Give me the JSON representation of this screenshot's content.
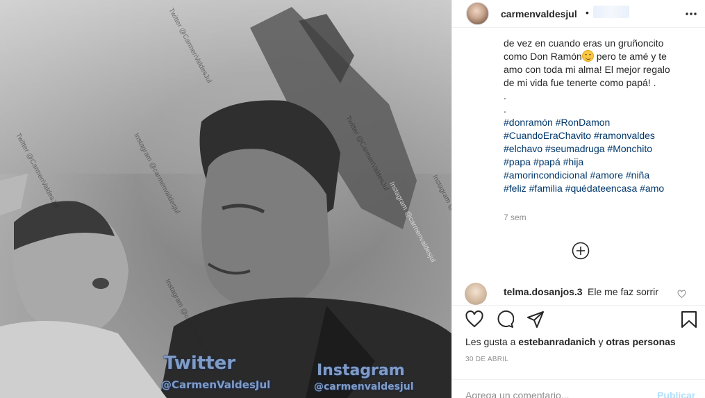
{
  "photo": {
    "watermark_twitter_title": "Twitter",
    "watermark_twitter_handle": "@CarmenValdesJul",
    "watermark_instagram_title": "Instagram",
    "watermark_instagram_handle": "@carmenvaldesjul",
    "small_watermarks": [
      "Twitter @CarmenValdesJul",
      "Instagram @carmenvaldesjul",
      "Twitter @CarmenValdesJul",
      "Instagram @carmenvaldesjul",
      "Instagram @carmenvaldesjul",
      "Twitter @CarmenValdesJul",
      "Instagram @carmenvaldesjul"
    ]
  },
  "header": {
    "username": "carmenvaldesjul",
    "separator": "•"
  },
  "caption": {
    "lines": [
      "de vez en cuando eras un gruñoncito",
      "como Don Ramón",
      " pero te amé y te",
      "amo con toda mi alma! El mejor regalo",
      "de mi vida fue tenerte como papá! .",
      ".",
      "."
    ],
    "hashtags": [
      "#donramón #RonDamon",
      "#CuandoEraChavito #ramonvaldes",
      "#elchavo #seumadruga #Monchito",
      "#papa #papá #hija",
      "#amorincondicional #amore #niña",
      "#feliz #familia #quédateencasa #amo"
    ],
    "time_ago": "7 sem"
  },
  "comment": {
    "username": "telma.dosanjos.3",
    "text": "Ele me faz sorrir"
  },
  "actions": {
    "likes_prefix": "Les gusta a",
    "likes_user": "estebanradanich",
    "likes_conjunction": "y",
    "likes_others": "otras personas",
    "date": "30 DE ABRIL"
  },
  "add_comment": {
    "placeholder": "Agrega un comentario...",
    "publish_label": "Publicar"
  },
  "icons": [
    "more-icon",
    "load-more-icon",
    "comment-like-icon",
    "heart-icon",
    "comment-icon",
    "share-icon",
    "save-icon"
  ]
}
